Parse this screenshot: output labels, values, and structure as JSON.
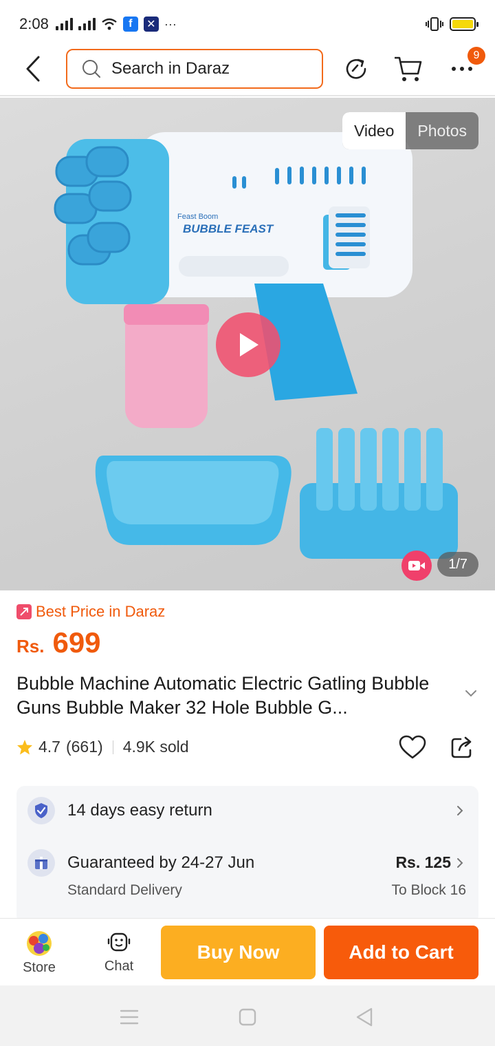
{
  "status_bar": {
    "time": "2:08",
    "more": "···"
  },
  "header": {
    "search_placeholder": "Search in Daraz",
    "notification_count": "9",
    "icons": [
      "back-icon",
      "search-icon",
      "history-icon",
      "cart-icon",
      "more-icon"
    ]
  },
  "gallery": {
    "tabs": [
      "Video",
      "Photos"
    ],
    "active_tab": "Video",
    "counter": "1/7",
    "box_text": [
      "Feast Boom",
      "BUBBLE FEAST"
    ]
  },
  "product": {
    "promo": "Best Price in Daraz",
    "currency": "Rs.",
    "price": "699",
    "title": "Bubble Machine Automatic Electric Gatling Bubble Guns Bubble Maker 32 Hole Bubble G...",
    "rating": "4.7",
    "reviews": "(661)",
    "sold": "4.9K sold"
  },
  "services": {
    "return_text": "14 days easy return",
    "delivery_text": "Guaranteed by 24-27 Jun",
    "delivery_sub": "Standard Delivery",
    "delivery_price": "Rs. 125",
    "delivery_location": "To Block 16"
  },
  "bottom_bar": {
    "store_label": "Store",
    "chat_label": "Chat",
    "buy_now": "Buy Now",
    "add_to_cart": "Add to Cart"
  },
  "colors": {
    "accent": "#f05a0c",
    "buy_now": "#fcae21",
    "add_to_cart": "#f75b0b",
    "play": "#f0506e"
  }
}
